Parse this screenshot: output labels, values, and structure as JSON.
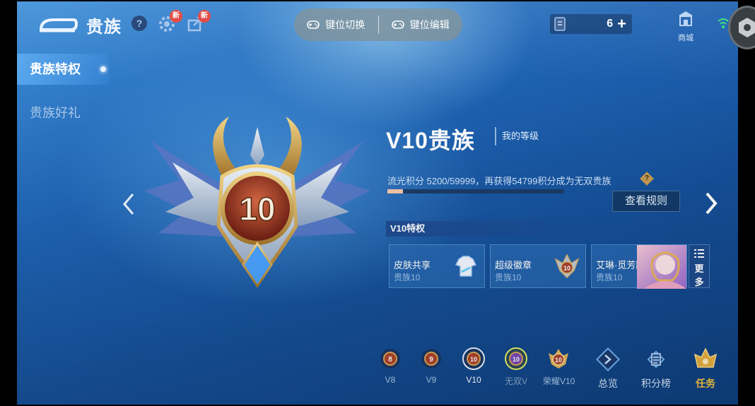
{
  "header": {
    "title": "贵族",
    "help_glyph": "?",
    "badge_new": "新",
    "key_switch": "键位切换",
    "key_edit": "键位编辑",
    "currency_count": "6",
    "currency_plus": "+",
    "shop_label": "商城"
  },
  "sidebar": {
    "items": [
      {
        "label": "贵族特权",
        "active": true
      },
      {
        "label": "贵族好礼",
        "active": false
      }
    ]
  },
  "level": {
    "emblem_number": "10",
    "title": "V10贵族",
    "my_level": "我的等级",
    "points_text": "流光积分 5200/59999，再获得54799积分成为无双贵族",
    "points_help": "?",
    "progress": 0.0867,
    "rules_button": "查看规则"
  },
  "privileges": {
    "title": "V10特权",
    "cards": [
      {
        "name": "皮肤共享",
        "sub": "贵族10",
        "icon": "shirt-icon"
      },
      {
        "name": "超级徽章",
        "sub": "贵族10",
        "icon": "badge-icon"
      },
      {
        "name": "艾琳·觅芳踪",
        "sub": "贵族10",
        "icon": "hero-portrait"
      }
    ],
    "more_line1": "更",
    "more_line2": "多"
  },
  "tiers": [
    {
      "label": "V8",
      "num": "8"
    },
    {
      "label": "V9",
      "num": "9"
    },
    {
      "label": "V10",
      "num": "10"
    },
    {
      "label": "无双V",
      "num": "10"
    },
    {
      "label": "荣耀V10",
      "num": "10"
    }
  ],
  "bottom": {
    "overview": "总览",
    "leaderboard": "积分榜",
    "tasks": "任务"
  },
  "colors": {
    "accent_gold": "#f7c743",
    "bg_blue": "#1f64b5",
    "emblem_red": "#a8402a"
  }
}
